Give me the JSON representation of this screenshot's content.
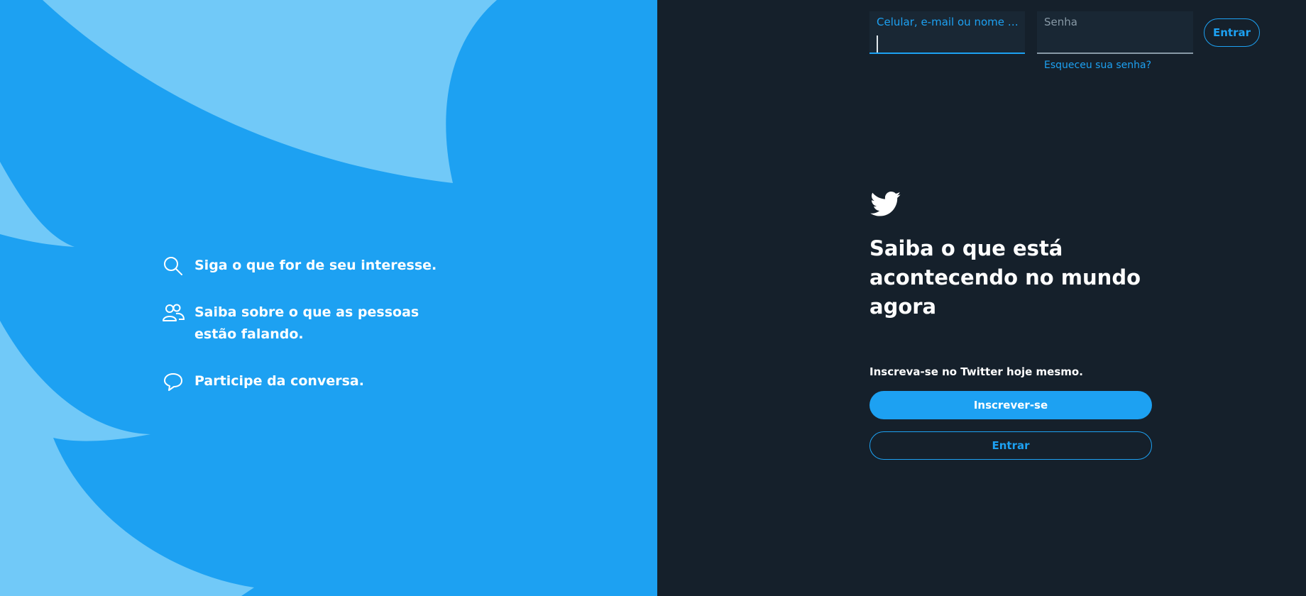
{
  "colors": {
    "brand_blue": "#1da1f2",
    "light_blue": "#71c9f8",
    "dark_bg": "#15202b",
    "field_bg": "#192734"
  },
  "features": [
    {
      "icon": "search-icon",
      "text": "Siga o que for de seu interesse."
    },
    {
      "icon": "people-icon",
      "text": "Saiba sobre o que as pessoas estão falando."
    },
    {
      "icon": "chat-bubble-icon",
      "text": "Participe da conversa."
    }
  ],
  "login_bar": {
    "username_placeholder": "Celular, e-mail ou nome d...",
    "password_placeholder": "Senha",
    "forgot_password": "Esqueceu sua senha?",
    "login_button": "Entrar"
  },
  "main": {
    "logo_icon": "twitter-bird-icon",
    "headline": "Saiba o que está acontecendo no mundo agora",
    "join_text": "Inscreva-se no Twitter hoje mesmo.",
    "signup_button": "Inscrever-se",
    "login_button": "Entrar"
  }
}
